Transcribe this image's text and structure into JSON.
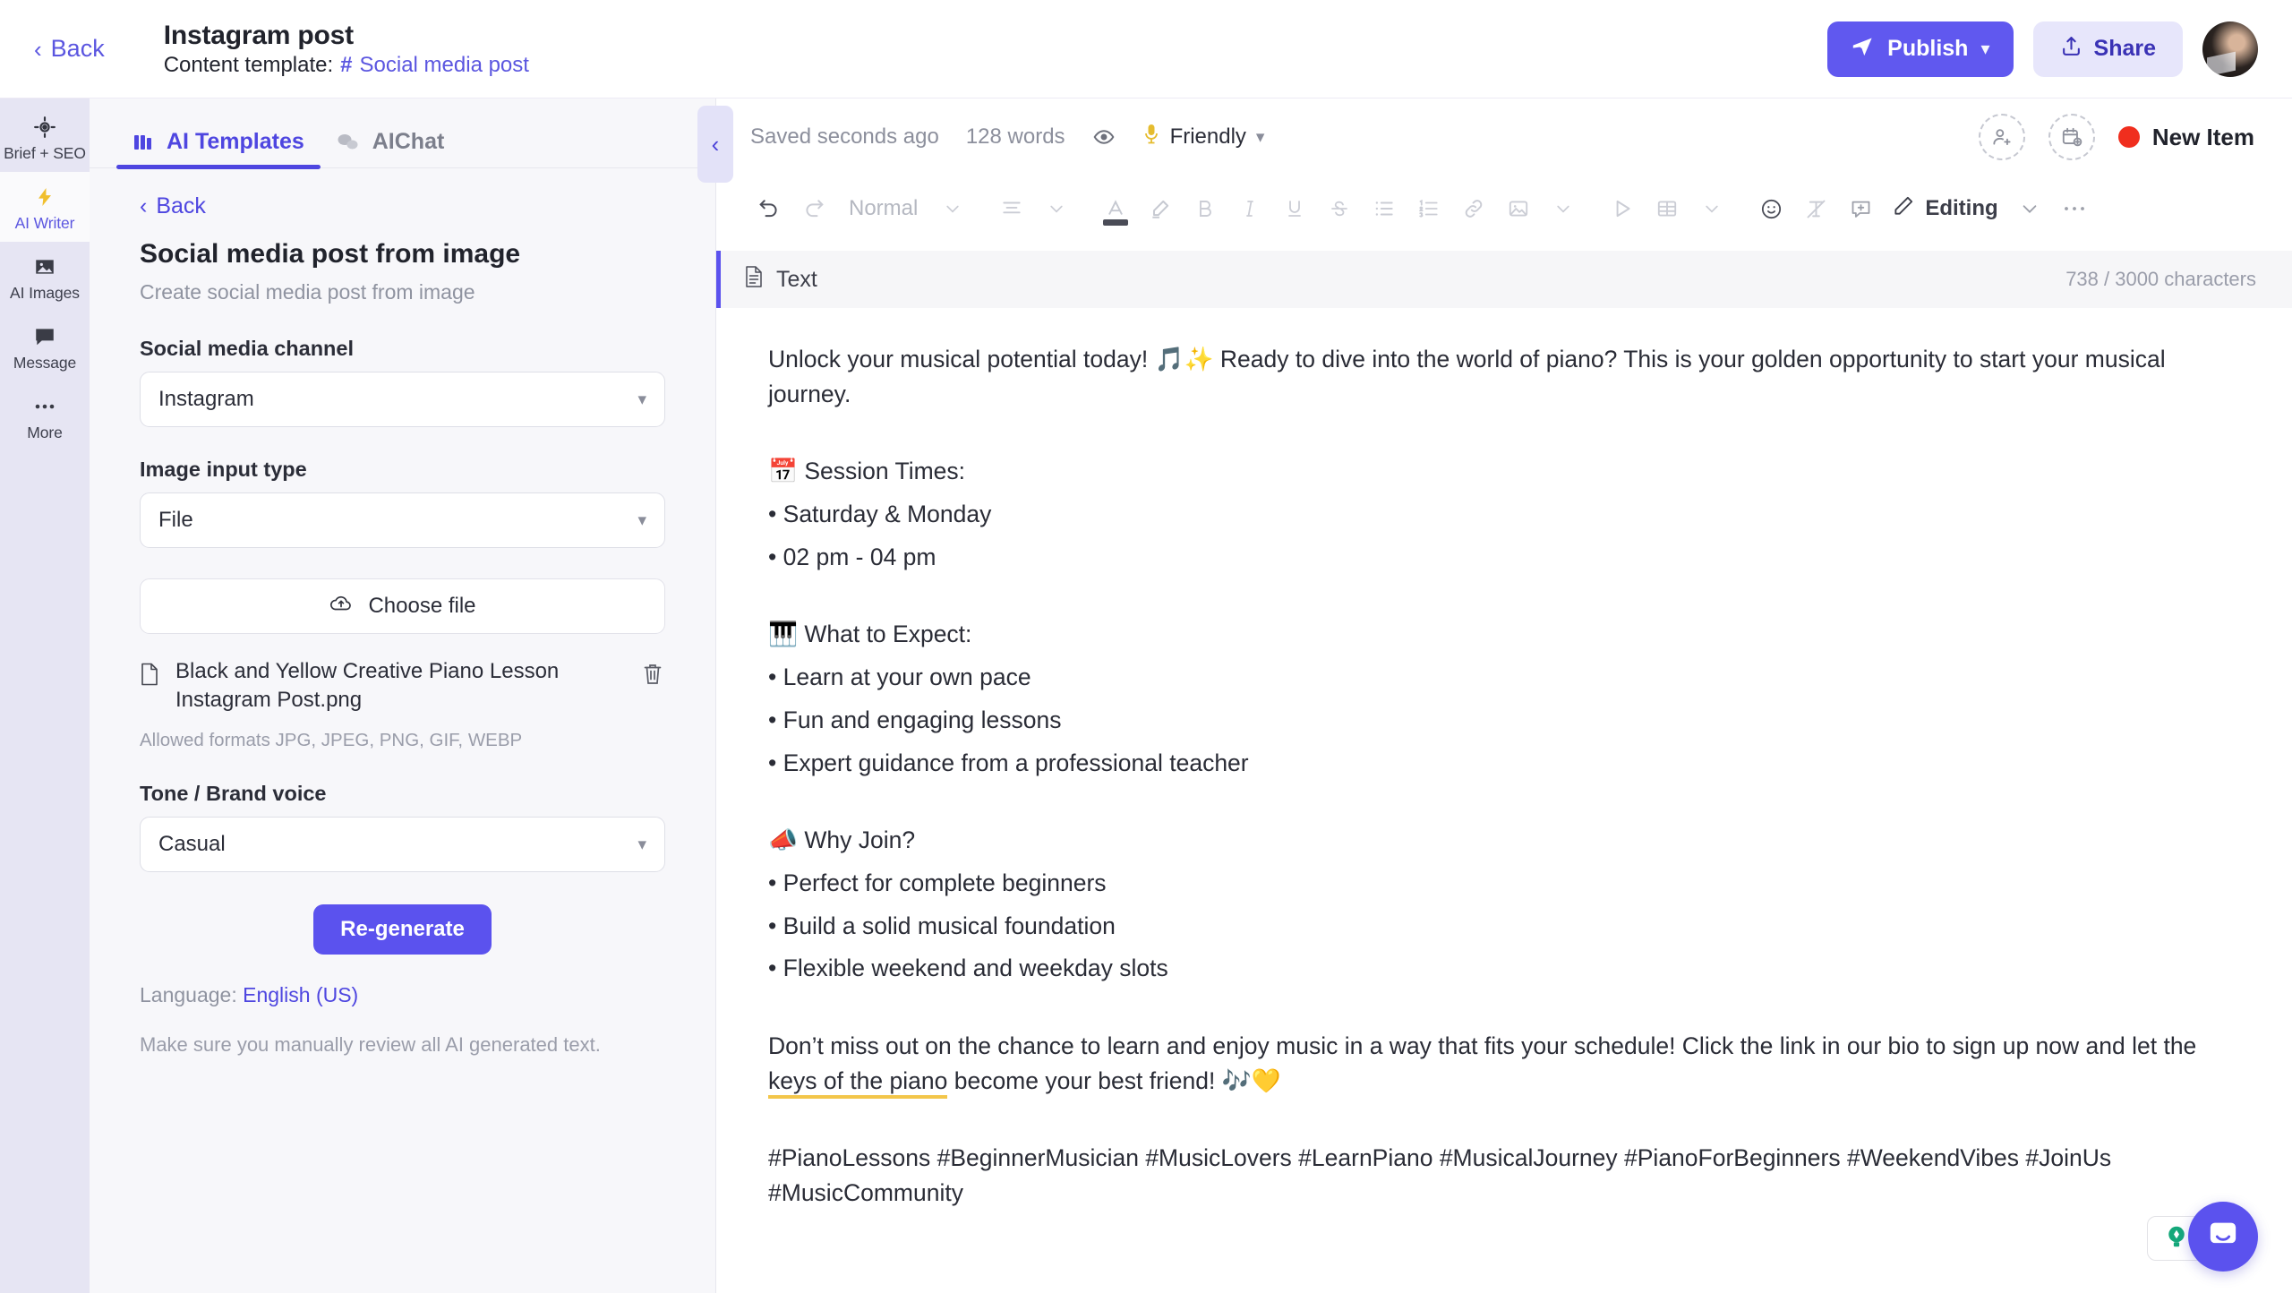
{
  "topbar": {
    "back_label": "Back",
    "doc_title": "Instagram post",
    "template_prefix": "Content template:",
    "template_hash": "#",
    "template_name": "Social media post",
    "publish_label": "Publish",
    "share_label": "Share",
    "accent_color": "#6058ef"
  },
  "rail": {
    "items": [
      {
        "label": "Brief + SEO",
        "icon": "target-icon",
        "active": false
      },
      {
        "label": "AI Writer",
        "icon": "lightning-icon",
        "active": true
      },
      {
        "label": "AI Images",
        "icon": "image-icon",
        "active": false
      },
      {
        "label": "Message",
        "icon": "chat-bubble-icon",
        "active": false
      },
      {
        "label": "More",
        "icon": "ellipsis-icon",
        "active": false
      }
    ]
  },
  "panel": {
    "tabs": [
      {
        "label": "AI Templates",
        "icon": "templates-icon",
        "active": true
      },
      {
        "label": "AIChat",
        "icon": "chat-icon",
        "active": false
      }
    ],
    "back_label": "Back",
    "heading": "Social media post from image",
    "subheading": "Create social media post from image",
    "fields": [
      {
        "label": "Social media channel",
        "value": "Instagram"
      },
      {
        "label": "Image input type",
        "value": "File"
      }
    ],
    "choose_file_label": "Choose file",
    "file_name": "Black and Yellow Creative Piano Lesson Instagram Post.png",
    "allowed_formats": "Allowed formats JPG, JPEG, PNG, GIF, WEBP",
    "tone_label": "Tone / Brand voice",
    "tone_value": "Casual",
    "regenerate_label": "Re-generate",
    "language_prefix": "Language:",
    "language_value": "English (US)",
    "disclaimer": "Make sure you manually review all AI generated text.",
    "collapse_icon": "chevron-left-icon"
  },
  "editor": {
    "saved_status": "Saved seconds ago",
    "word_count": "128 words",
    "tone_label": "Friendly",
    "new_item_label": "New Item",
    "new_item_dot_color": "#f02e1e",
    "toolbar": {
      "style_label": "Normal",
      "mode_label": "Editing",
      "icons": [
        "undo-icon",
        "redo-icon",
        "align-icon",
        "font-color-icon",
        "highlight-icon",
        "bold-icon",
        "italic-icon",
        "underline-icon",
        "strikethrough-icon",
        "bullet-list-icon",
        "numbered-list-icon",
        "link-icon",
        "image-insert-icon",
        "media-play-icon",
        "table-icon",
        "emoji-icon",
        "clear-format-icon",
        "comment-icon",
        "pencil-icon",
        "more-options-icon"
      ]
    },
    "block": {
      "title": "Text",
      "char_count": "738 / 3000 characters"
    },
    "content": {
      "intro": "Unlock your musical potential today! 🎵✨ Ready to dive into the world of piano? This is your golden opportunity to start your musical journey.",
      "sessions_heading": "📅 Session Times:",
      "sessions": [
        "• Saturday & Monday",
        "• 02 pm - 04 pm"
      ],
      "expect_heading": "🎹 What to Expect:",
      "expect": [
        "• Learn at your own pace",
        "• Fun and engaging lessons",
        "• Expert guidance from a professional teacher"
      ],
      "why_heading": "📣 Why Join?",
      "why": [
        "• Perfect for complete beginners",
        "• Build a solid musical foundation",
        "• Flexible weekend and weekday slots"
      ],
      "closing_a": "Don’t miss out on the chance to learn and enjoy music in a way that fits your schedule! Click the link in our bio to sign up now and let the ",
      "closing_highlight": "keys of the piano",
      "closing_b": " become your best friend! 🎶💛",
      "hashtags": "#PianoLessons #BeginnerMusician #MusicLovers #LearnPiano #MusicalJourney #PianoForBeginners #WeekendVibes #JoinUs #MusicCommunity"
    }
  },
  "widgets": {
    "grammarly": "grammarly-icon",
    "chat": "intercom-chat-icon"
  }
}
